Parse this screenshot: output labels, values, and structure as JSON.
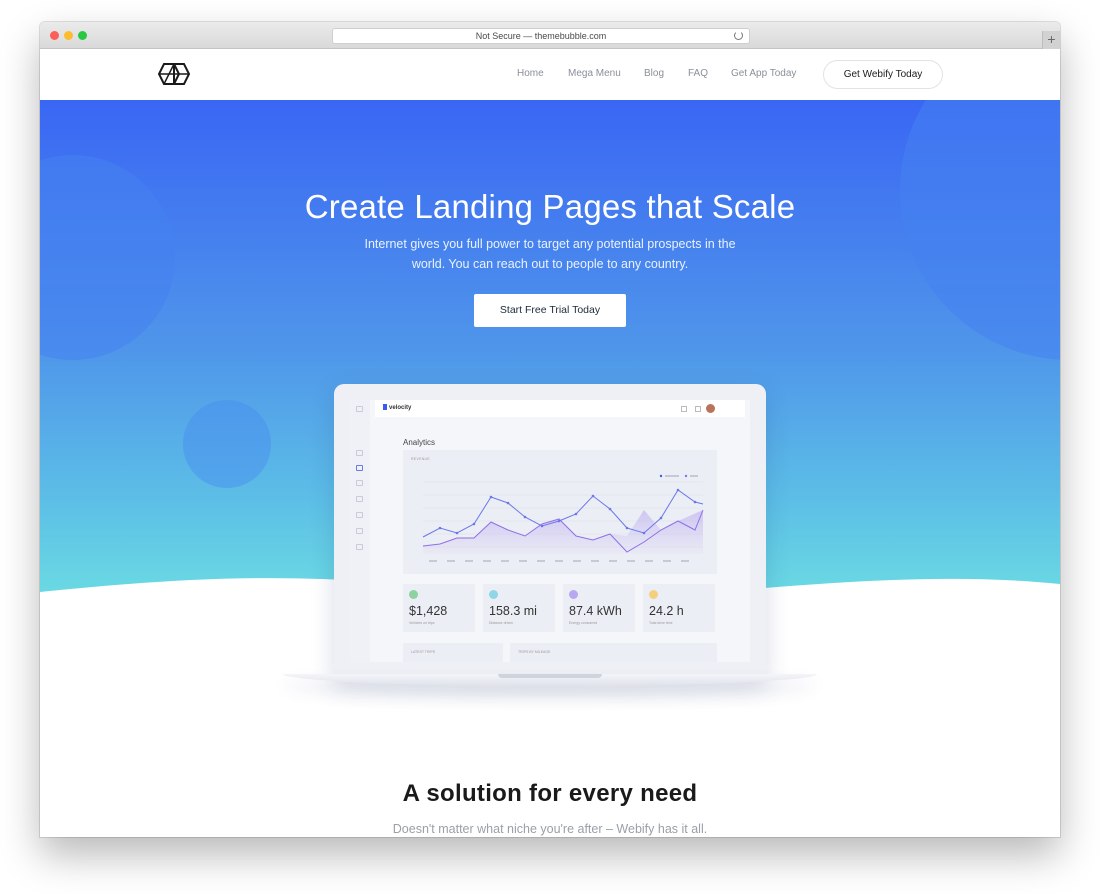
{
  "browser": {
    "url_text": "Not Secure — themebubble.com",
    "new_tab_label": "+"
  },
  "nav": {
    "links": [
      "Home",
      "Mega Menu",
      "Blog",
      "FAQ",
      "Get App Today"
    ],
    "cta": "Get Webify Today"
  },
  "hero": {
    "title": "Create Landing Pages that Scale",
    "subtitle": "Internet gives you full power to target any potential prospects in the world. You can reach out to people to any country.",
    "button": "Start Free Trial Today"
  },
  "dashboard": {
    "brand": "velocity",
    "heading": "Analytics",
    "chart_caption": "REVENUE",
    "stats": [
      {
        "value": "$1,428",
        "label": "Vehicles on trips",
        "color": "#8fd1a0"
      },
      {
        "value": "158.3 mi",
        "label": "Distance driven",
        "color": "#8fd7e6"
      },
      {
        "value": "87.4 kWh",
        "label": "Energy consumed",
        "color": "#b9a7ef"
      },
      {
        "value": "24.2 h",
        "label": "Total drive time",
        "color": "#f3d07e"
      }
    ],
    "bottom_cards": [
      "LATEST TRIPS",
      "TRIPS BY MILEAGE"
    ]
  },
  "section": {
    "title": "A solution for every need",
    "subtitle": "Doesn't matter what niche you're after – Webify has it all."
  },
  "colors": {
    "hero_top": "#3a66f4",
    "hero_bottom": "#6ee1e2",
    "series_1": "#6b78e8",
    "series_2": "#8f6fe6"
  }
}
